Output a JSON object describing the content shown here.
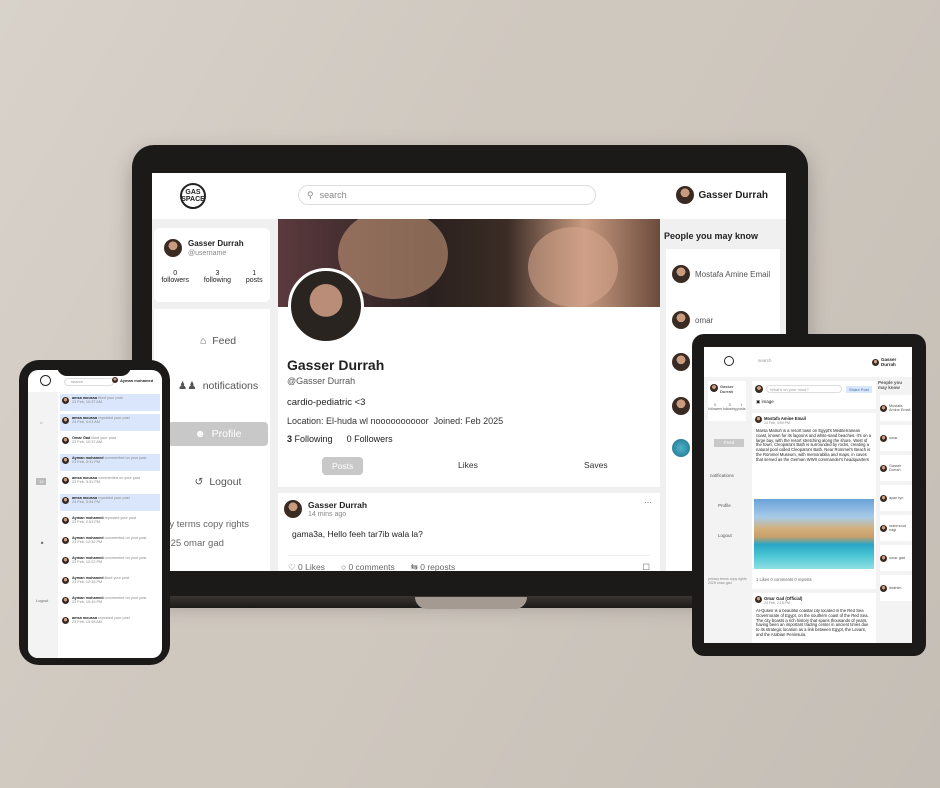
{
  "brand": {
    "logo_text": "GAS\nSPACE"
  },
  "search": {
    "placeholder": "search"
  },
  "current_user": {
    "name": "Gasser Durrah",
    "username": "@username"
  },
  "profile_card": {
    "stats": [
      {
        "value": "0",
        "label": "followers"
      },
      {
        "value": "3",
        "label": "following"
      },
      {
        "value": "1",
        "label": "posts"
      }
    ]
  },
  "nav": [
    {
      "label": "Feed",
      "icon": "home-icon"
    },
    {
      "label": "notifications",
      "icon": "people-icon"
    },
    {
      "label": "Profile",
      "icon": "user-icon"
    },
    {
      "label": "Logout",
      "icon": "logout-icon"
    }
  ],
  "footer": {
    "line1": "privacy terms  copy rights",
    "line2": "2025  omar gad"
  },
  "profile": {
    "name": "Gasser Durrah",
    "handle": "@Gasser Durrah",
    "bio": "cardio-pediatric <3",
    "location": "Location: El-huda wl noooooooooor",
    "joined": "Joined: Feb 2025",
    "following_count": "3",
    "following_label": "Following",
    "followers_count": "0",
    "followers_label": "Followers"
  },
  "tabs": [
    {
      "label": "Posts",
      "active": true
    },
    {
      "label": "Likes",
      "active": false
    },
    {
      "label": "Saves",
      "active": false
    }
  ],
  "post": {
    "author": "Gasser Durrah",
    "time": "14 mins ago",
    "body": "gama3a, Hello feeh tar7ib wala la?",
    "likes": "0 Likes",
    "comments": "0 comments",
    "reposts": "0 reposts"
  },
  "suggestions": {
    "title": "People you may know",
    "items": [
      "Mostafa Amine Email",
      "omar",
      "",
      "",
      ""
    ]
  },
  "phone": {
    "user": "Ayman mohamed",
    "search": "search",
    "notifications": [
      {
        "user": "amsa moussa",
        "action": "liked your post",
        "time": "23 Feb, 10:37 AM",
        "hl": true
      },
      {
        "user": "amsa moussa",
        "action": "reposted your post",
        "time": "23 Feb, 4:03 AM",
        "hl": true
      },
      {
        "user": "Omar Gad",
        "action": "liked your post",
        "time": "23 Feb, 10:37 AM",
        "hl": false
      },
      {
        "user": "Ayman mohamed",
        "action": "commented on your post",
        "time": "23 Feb, 3:31 PM",
        "hl": true
      },
      {
        "user": "amsa moussa",
        "action": "commented on your post",
        "time": "23 Feb, 3:31 PM",
        "hl": false
      },
      {
        "user": "amsa moussa",
        "action": "reposted your post",
        "time": "23 Feb, 3:34 PM",
        "hl": true
      },
      {
        "user": "Ayman mohamed",
        "action": "reposted your post",
        "time": "23 Feb, 2:53 PM",
        "hl": false
      },
      {
        "user": "Ayman mohamed",
        "action": "commented on your post",
        "time": "23 Feb, 12:32 PM",
        "hl": false
      },
      {
        "user": "Ayman mohamed",
        "action": "commented on your post",
        "time": "23 Feb, 12:22 PM",
        "hl": false
      },
      {
        "user": "Ayman mohamed",
        "action": "liked your post",
        "time": "23 Feb, 12:18 PM",
        "hl": false
      },
      {
        "user": "Ayman mohamed",
        "action": "commented on your post",
        "time": "23 Feb, 10:49 PM",
        "hl": false
      },
      {
        "user": "amsa moussa",
        "action": "reposted your post",
        "time": "23 Feb, 10:08 AM",
        "hl": false
      }
    ],
    "logout": "Logout",
    "badge": "12"
  },
  "tablet": {
    "user": "Gasser Durrah",
    "compose_placeholder": "What's on your mind?",
    "share_button": "Share Post",
    "image_label": "image",
    "feed_label": "Feed",
    "notifications_label": "notifications",
    "profile_label": "Profile",
    "logout_label": "Logout",
    "footer": "privacy terms  copy rights 2025  omar gad",
    "post1": {
      "author": "Mostafa Amine Email",
      "time": "24 Feb, 3:59 PM",
      "body": "Marsa Matruh is a resort town on Egypt's Mediterranean coast, known for its lagoons and white-sand beaches. It's on a large bay, with the resort stretching along the shore. West of the town, Cleopatra's Bath is surrounded by rocks, creating a natural pool called Cleopatra's Bath. Near Rommel's Beach is the Rommel Museum, with memorabilia and maps, in caves that served as the German WWII commander's headquarters",
      "actions": "1 Likes  0 comments  0 reposts"
    },
    "post2": {
      "author": "Omar Gad (Official)",
      "time": "24 Feb, 2:18 PM",
      "body": "Al-Quseir is a beautiful coastal city located in the Red Sea Governorate of Egypt, on the southern coast of the Red Sea. The city boasts a rich history that spans thousands of years, having been an important trading center in ancient times due to its strategic location as a link between Egypt, the Levant, and the Arabian Peninsula."
    },
    "suggestions": [
      "Mostafa Amine Email",
      "omar",
      "Gasser Durrah",
      "ayan tyn",
      "mahmoud nagi",
      "omar gad",
      "ibrahim"
    ]
  }
}
